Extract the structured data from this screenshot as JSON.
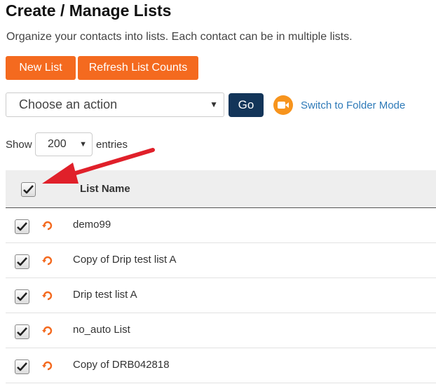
{
  "page": {
    "title": "Create / Manage Lists",
    "description": "Organize your contacts into lists. Each contact can be in multiple lists."
  },
  "buttons": {
    "new_list": "New List",
    "refresh_counts": "Refresh List Counts",
    "go": "Go"
  },
  "action_select": {
    "selected": "Choose an action"
  },
  "folder_mode": {
    "label": "Switch to Folder Mode",
    "icon": "video-camera-icon"
  },
  "pagination": {
    "show_label": "Show",
    "entries_value": "200",
    "entries_label": "entries"
  },
  "table": {
    "select_all_checked": true,
    "column_header": "List Name",
    "rows": [
      {
        "name": "demo99",
        "checked": true,
        "icon": "sync-icon"
      },
      {
        "name": "Copy of Drip test list A",
        "checked": true,
        "icon": "sync-icon"
      },
      {
        "name": "Drip test list A",
        "checked": true,
        "icon": "sync-icon"
      },
      {
        "name": "no_auto List",
        "checked": true,
        "icon": "sync-icon"
      },
      {
        "name": "Copy of DRB042818",
        "checked": true,
        "icon": "sync-icon"
      }
    ]
  },
  "colors": {
    "orange_button": "#f46a1f",
    "go_button": "#133559",
    "link": "#2e7ab8",
    "folder_icon": "#f7941d",
    "sync_icon": "#f46a1f",
    "annotation_arrow": "#e0202a"
  }
}
